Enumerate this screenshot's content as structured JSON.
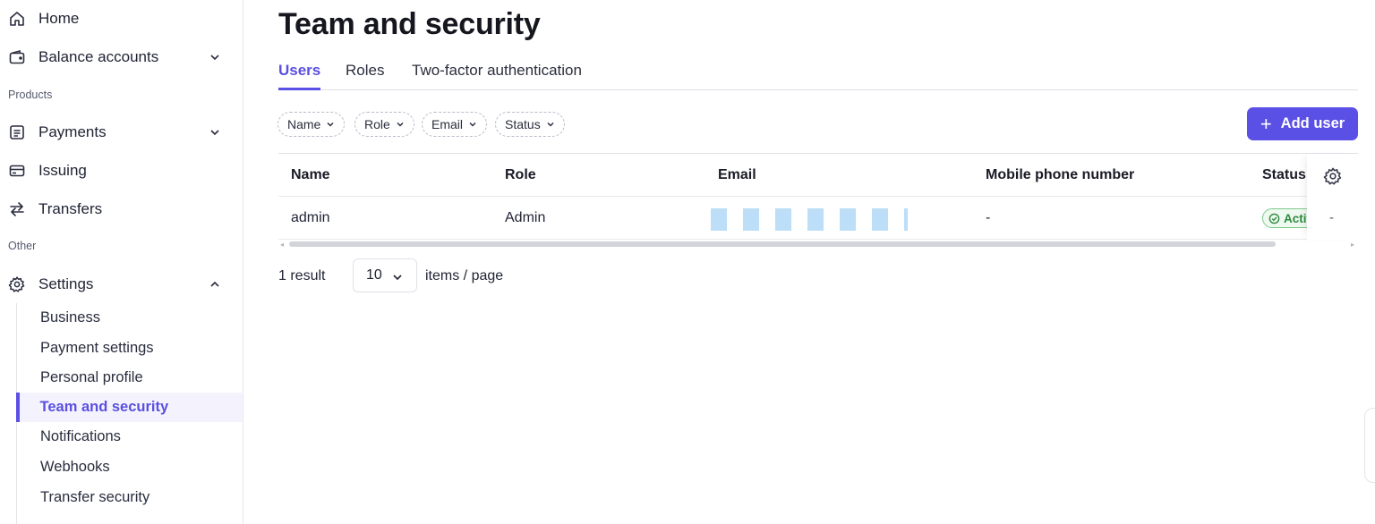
{
  "sidebar": {
    "home": "Home",
    "balance_accounts": "Balance accounts",
    "products_label": "Products",
    "payments": "Payments",
    "issuing": "Issuing",
    "transfers": "Transfers",
    "other_label": "Other",
    "settings": "Settings",
    "settings_items": [
      "Business",
      "Payment settings",
      "Personal profile",
      "Team and security",
      "Notifications",
      "Webhooks",
      "Transfer security"
    ],
    "active_item": "Team and security"
  },
  "page": {
    "title": "Team and security"
  },
  "tabs": [
    "Users",
    "Roles",
    "Two-factor authentication"
  ],
  "active_tab": "Users",
  "filters": [
    "Name",
    "Role",
    "Email",
    "Status"
  ],
  "add_user_label": "Add user",
  "table": {
    "columns": [
      "Name",
      "Role",
      "Email",
      "Mobile phone number",
      "Status"
    ],
    "rows": [
      {
        "name": "admin",
        "role": "Admin",
        "email": "",
        "mobile": "-",
        "status": "Active",
        "extra": "-"
      }
    ]
  },
  "pagination": {
    "result_text": "1 result",
    "page_size": "10",
    "items_per_page_text": "items / page"
  },
  "colors": {
    "accent": "#5b50e6",
    "active_bg": "#f4f3fd",
    "status_green": "#2f8a3e"
  },
  "icons": {
    "home": "home-icon",
    "balance": "wallet-icon",
    "payments": "receipt-icon",
    "issuing": "card-icon",
    "transfers": "arrows-swap-icon",
    "settings": "gear-icon"
  }
}
